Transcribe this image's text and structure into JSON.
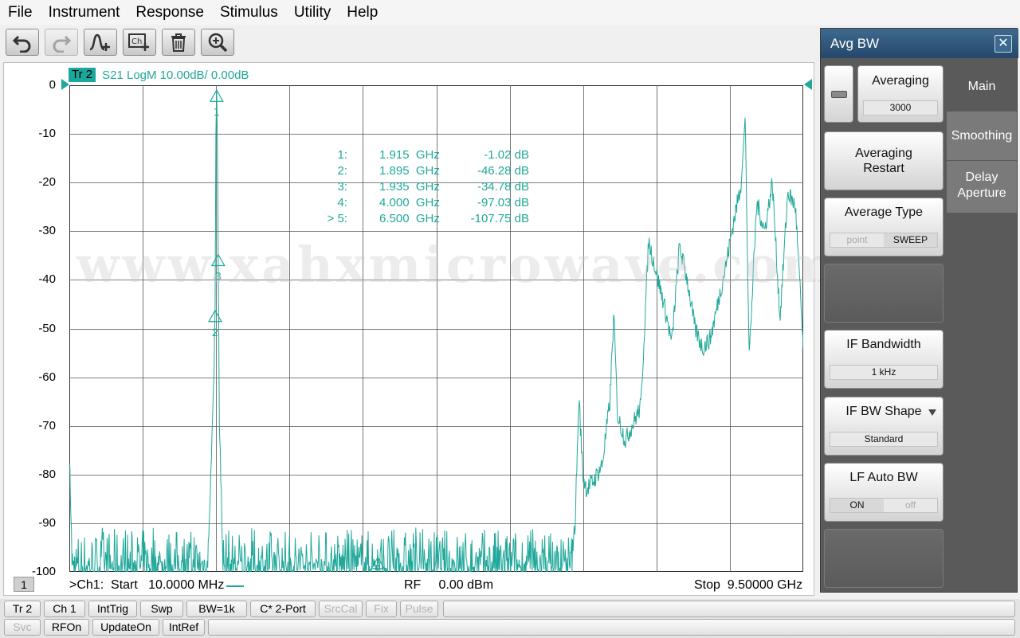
{
  "menu": [
    "File",
    "Instrument",
    "Response",
    "Stimulus",
    "Utility",
    "Help"
  ],
  "toolbar": [
    {
      "icon": "undo-icon",
      "enabled": true
    },
    {
      "icon": "redo-icon",
      "enabled": false
    },
    {
      "icon": "add-marker-icon",
      "enabled": true
    },
    {
      "icon": "add-channel-icon",
      "enabled": true
    },
    {
      "icon": "delete-icon",
      "enabled": true
    },
    {
      "icon": "zoom-icon",
      "enabled": true
    }
  ],
  "trace": {
    "tag": "Tr 2",
    "description": "S21 LogM 10.00dB/  0.00dB",
    "color": "#20a89a"
  },
  "y_axis_labels": [
    "0",
    "-10",
    "-20",
    "-30",
    "-40",
    "-50",
    "-60",
    "-70",
    "-80",
    "-90",
    "-100"
  ],
  "markers": [
    {
      "id": "1:",
      "freq": "1.915  GHz",
      "value": "-1.02 dB"
    },
    {
      "id": "2:",
      "freq": "1.895  GHz",
      "value": "-46.28 dB"
    },
    {
      "id": "3:",
      "freq": "1.935  GHz",
      "value": "-34.78 dB"
    },
    {
      "id": "4:",
      "freq": "4.000  GHz",
      "value": "-97.03 dB"
    },
    {
      "id": "> 5:",
      "freq": "6.500  GHz",
      "value": "-107.75 dB"
    }
  ],
  "marker_labels": [
    "1",
    "2",
    "3",
    "4",
    "5"
  ],
  "watermark": "www.xahxmicrowave.com",
  "bottom": {
    "channel_num": "1",
    "start": ">Ch1:  Start   10.0000 MHz",
    "power": "RF     0.00 dBm",
    "stop": "Stop  9.50000 GHz"
  },
  "status_row1": [
    {
      "label": "Tr 2",
      "enabled": true
    },
    {
      "label": "Ch 1",
      "enabled": true
    },
    {
      "label": "IntTrig",
      "enabled": true
    },
    {
      "label": "Swp",
      "enabled": true
    },
    {
      "label": "BW=1k",
      "enabled": true
    },
    {
      "label": "C* 2-Port",
      "enabled": true
    },
    {
      "label": "SrcCal",
      "enabled": false
    },
    {
      "label": "Fix",
      "enabled": false
    },
    {
      "label": "Pulse",
      "enabled": false
    }
  ],
  "status_row2": [
    {
      "label": "Svc",
      "enabled": false
    },
    {
      "label": "RFOn",
      "enabled": true
    },
    {
      "label": "UpdateOn",
      "enabled": true
    },
    {
      "label": "IntRef",
      "enabled": true
    }
  ],
  "panel": {
    "title": "Avg BW",
    "averaging": {
      "title": "Averaging",
      "value": "3000"
    },
    "averaging_restart": "Averaging\nRestart",
    "average_type": {
      "title": "Average Type",
      "options": [
        "point",
        "SWEEP"
      ]
    },
    "if_bandwidth": {
      "title": "IF Bandwidth",
      "value": "1 kHz"
    },
    "if_bw_shape": {
      "title": "IF BW Shape",
      "value": "Standard"
    },
    "lf_auto_bw": {
      "title": "LF Auto BW",
      "options": [
        "ON",
        "off"
      ]
    },
    "tabs": [
      "Main",
      "Smoothing",
      "Delay\nAperture"
    ]
  },
  "chart_data": {
    "type": "line",
    "title": "",
    "x_range_ghz": [
      0.01,
      9.5
    ],
    "ylim": [
      -100,
      0
    ],
    "y_div_db": 10,
    "grid": true,
    "series": [
      {
        "name": "S21 LogM",
        "x_ghz": [
          0.01,
          0.05,
          0.2,
          0.5,
          1.0,
          1.5,
          1.8,
          1.88,
          1.895,
          1.905,
          1.915,
          1.925,
          1.935,
          1.95,
          2.0,
          2.5,
          3.0,
          3.5,
          4.0,
          4.5,
          5.0,
          5.5,
          6.0,
          6.3,
          6.45,
          6.5,
          6.55,
          6.6,
          6.65,
          6.7,
          6.8,
          6.9,
          7.0,
          7.05,
          7.1,
          7.2,
          7.4,
          7.5,
          7.7,
          7.8,
          7.9,
          8.0,
          8.1,
          8.2,
          8.3,
          8.5,
          8.6,
          8.7,
          8.75,
          8.8,
          8.9,
          9.0,
          9.1,
          9.2,
          9.3,
          9.4,
          9.5
        ],
        "y_db": [
          -76,
          -99,
          -98,
          -99,
          -99,
          -99,
          -98,
          -60,
          -46.28,
          -10,
          -1.02,
          -12,
          -34.78,
          -70,
          -99,
          -99,
          -98,
          -99,
          -97.03,
          -99,
          -99,
          -98,
          -99,
          -98,
          -99,
          -99,
          -90,
          -64,
          -80,
          -83,
          -81,
          -78,
          -65,
          -47,
          -68,
          -73,
          -66,
          -32,
          -45,
          -53,
          -33,
          -40,
          -50,
          -54,
          -52,
          -37,
          -28,
          -20,
          -6,
          -56,
          -24,
          -30,
          -20,
          -48,
          -22,
          -25,
          -54
        ]
      }
    ]
  }
}
